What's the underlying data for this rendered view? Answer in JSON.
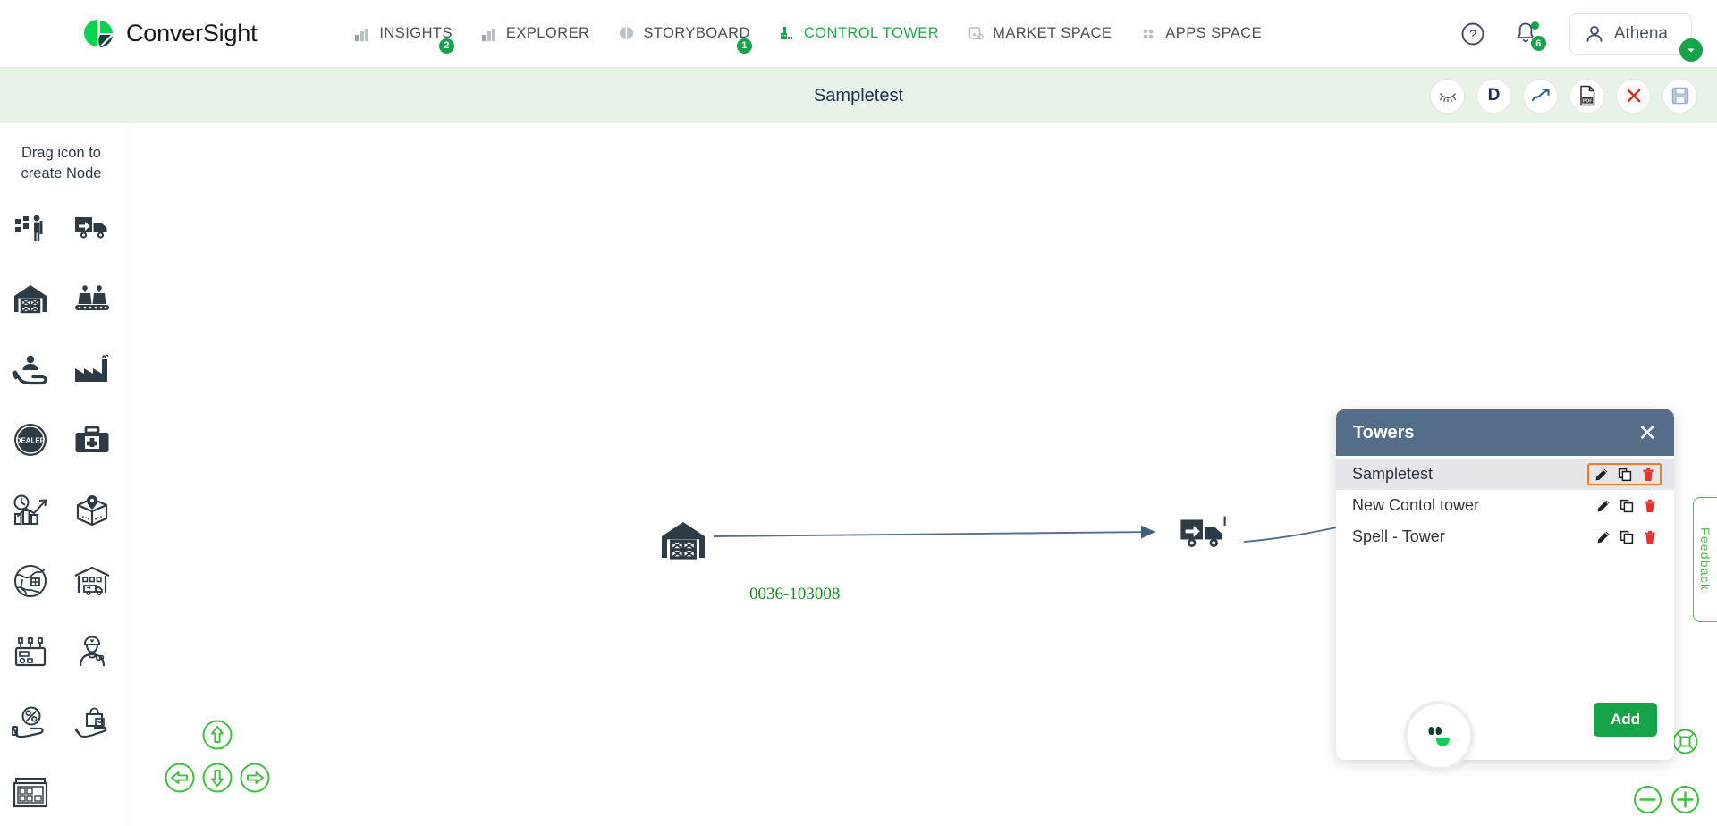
{
  "brand": {
    "name": "ConverSight",
    "logo_icon": "conversight-logo-icon",
    "accent_green": "#17a34a",
    "dark_green": "#0b4536"
  },
  "header": {
    "nav": [
      {
        "label": "INSIGHTS",
        "icon": "bar-chart-icon",
        "badge": "2",
        "active": false
      },
      {
        "label": "EXPLORER",
        "icon": "bar-chart-icon",
        "badge": "",
        "active": false
      },
      {
        "label": "STORYBOARD",
        "icon": "storyboard-icon",
        "badge": "1",
        "active": false
      },
      {
        "label": "CONTROL TOWER",
        "icon": "control-tower-icon",
        "badge": "",
        "active": true
      },
      {
        "label": "MARKET SPACE",
        "icon": "market-space-icon",
        "badge": "",
        "active": false
      },
      {
        "label": "APPS SPACE",
        "icon": "apps-grid-icon",
        "badge": "",
        "active": false
      }
    ],
    "help_icon": "help-circle-icon",
    "bell_icon": "bell-icon",
    "bell_badge": "6",
    "user_icon": "user-avatar-icon",
    "user_name": "Athena",
    "user_caret_icon": "chevron-down-icon"
  },
  "subheader": {
    "title": "Sampletest",
    "tools": [
      {
        "name": "hide-eye-button",
        "icon": "eye-closed-icon"
      },
      {
        "name": "data-button",
        "icon": "letter-d-icon",
        "label": "D"
      },
      {
        "name": "trend-button",
        "icon": "trending-up-icon"
      },
      {
        "name": "export-pdf-button",
        "icon": "pdf-file-icon",
        "label": "PDF"
      },
      {
        "name": "close-button",
        "icon": "close-x-icon"
      },
      {
        "name": "save-button",
        "icon": "floppy-save-icon"
      }
    ]
  },
  "sidebar": {
    "title": "Drag icon to create Node",
    "icons": [
      {
        "name": "inventory-worker-icon",
        "label": "Inventory Worker"
      },
      {
        "name": "outbound-truck-icon",
        "label": "Outbound Truck"
      },
      {
        "name": "warehouse-icon",
        "label": "Warehouse"
      },
      {
        "name": "assembly-line-icon",
        "label": "Assembly Line"
      },
      {
        "name": "customer-care-icon",
        "label": "Customer Care"
      },
      {
        "name": "factory-icon",
        "label": "Factory"
      },
      {
        "name": "dealer-icon",
        "label": "Dealer"
      },
      {
        "name": "medical-kit-icon",
        "label": "Medical Kit"
      },
      {
        "name": "performance-chart-icon",
        "label": "Performance"
      },
      {
        "name": "package-location-icon",
        "label": "Package Location"
      },
      {
        "name": "global-shipping-icon",
        "label": "Global Shipping"
      },
      {
        "name": "distribution-center-icon",
        "label": "Distribution Center"
      },
      {
        "name": "machinery-icon",
        "label": "Machinery"
      },
      {
        "name": "field-staff-icon",
        "label": "Field Staff"
      },
      {
        "name": "discount-icon",
        "label": "Discount"
      },
      {
        "name": "retail-bag-icon",
        "label": "Retail"
      },
      {
        "name": "storage-rack-icon",
        "label": "Storage Rack"
      }
    ]
  },
  "canvas": {
    "nodes": [
      {
        "id": "n1",
        "type": "warehouse-node",
        "icon": "warehouse-icon",
        "label": "0036-103008"
      },
      {
        "id": "n2",
        "type": "truck-node",
        "icon": "outbound-truck-icon",
        "label": ""
      },
      {
        "id": "n3",
        "type": "warehouse-node",
        "icon": "warehouse-icon",
        "label": ""
      },
      {
        "id": "n4",
        "type": "distribution-node",
        "icon": "inventory-worker-icon",
        "label": ""
      }
    ],
    "edges": [
      {
        "from": "n1",
        "to": "n2"
      },
      {
        "from": "n2",
        "to": "n3"
      },
      {
        "from": "n3",
        "to": "n4"
      }
    ],
    "edge_color": "#4b6a8a",
    "node_label_color": "#148c1f",
    "pan_controls": [
      {
        "name": "pan-up-button",
        "icon": "arrow-up-circle-icon"
      },
      {
        "name": "pan-left-button",
        "icon": "arrow-left-circle-icon"
      },
      {
        "name": "pan-down-button",
        "icon": "arrow-down-circle-icon"
      },
      {
        "name": "pan-right-button",
        "icon": "arrow-right-circle-icon"
      }
    ],
    "zoom_controls": [
      {
        "name": "fit-to-screen-button",
        "icon": "fit-screen-icon"
      },
      {
        "name": "zoom-out-button",
        "icon": "minus-circle-icon"
      },
      {
        "name": "zoom-in-button",
        "icon": "plus-circle-icon"
      }
    ]
  },
  "towers_panel": {
    "title": "Towers",
    "close_icon": "close-x-icon",
    "header_color": "#546e8a",
    "highlight_color": "#f07b23",
    "rows": [
      {
        "name": "Sampletest",
        "selected": true,
        "actions": [
          {
            "icon": "edit-pencil-icon"
          },
          {
            "icon": "copy-icon"
          },
          {
            "icon": "delete-trash-icon"
          }
        ]
      },
      {
        "name": "New Contol tower",
        "selected": false,
        "actions": [
          {
            "icon": "edit-pencil-icon"
          },
          {
            "icon": "copy-icon"
          },
          {
            "icon": "delete-trash-icon"
          }
        ]
      },
      {
        "name": "Spell - Tower",
        "selected": false,
        "actions": [
          {
            "icon": "edit-pencil-icon"
          },
          {
            "icon": "copy-icon"
          },
          {
            "icon": "delete-trash-icon"
          }
        ]
      }
    ],
    "add_label": "Add"
  },
  "assistant": {
    "icon": "assistant-smile-icon"
  },
  "feedback": {
    "label": "Feedback",
    "color": "#55b956"
  }
}
